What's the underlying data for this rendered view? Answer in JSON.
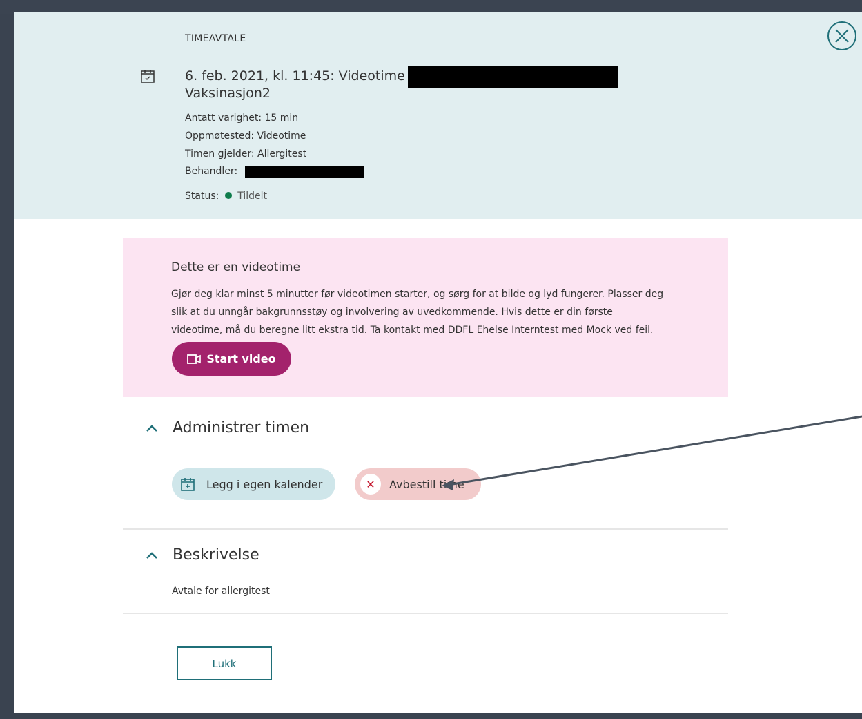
{
  "appointment": {
    "kicker": "TIMEAVTALE",
    "title_line1": "6. feb. 2021, kl. 11:45: Videotime hos",
    "title_line2": "Vaksinasjon2",
    "duration": "Antatt varighet: 15 min",
    "location": "Oppmøtested: Videotime",
    "concerns": "Timen gjelder: Allergitest",
    "practitioner_label": "Behandler:",
    "status_label": "Status:",
    "status_value": "Tildelt",
    "status_color": "#0e7c4c"
  },
  "video": {
    "heading": "Dette er en videotime",
    "text_line1": "Gjør deg klar minst 5 minutter før videotimen starter, og sørg for at bilde og lyd fungerer. Plasser deg",
    "text_line2": "slik at du unngår bakgrunnsstøy og involvering av uvedkommende. Hvis dette er din første",
    "text_line3": "videotime, må du beregne litt ekstra tid. Ta kontakt med DDFL Ehelse Interntest med Mock ved feil.",
    "start_label": "Start video",
    "accent_color": "#a3226c",
    "box_color": "#fce4f2"
  },
  "manage": {
    "heading": "Administrer timen",
    "calendar_label": "Legg i egen kalender",
    "cancel_label": "Avbestill time"
  },
  "description": {
    "heading": "Beskrivelse",
    "text": "Avtale for allergitest"
  },
  "footer": {
    "close_label": "Lukk"
  },
  "icons": {
    "close": "close-circle-icon",
    "calendar": "calendar-icon",
    "video": "video-camera-icon",
    "chevron": "chevron-up-icon",
    "cancel": "x-icon"
  }
}
